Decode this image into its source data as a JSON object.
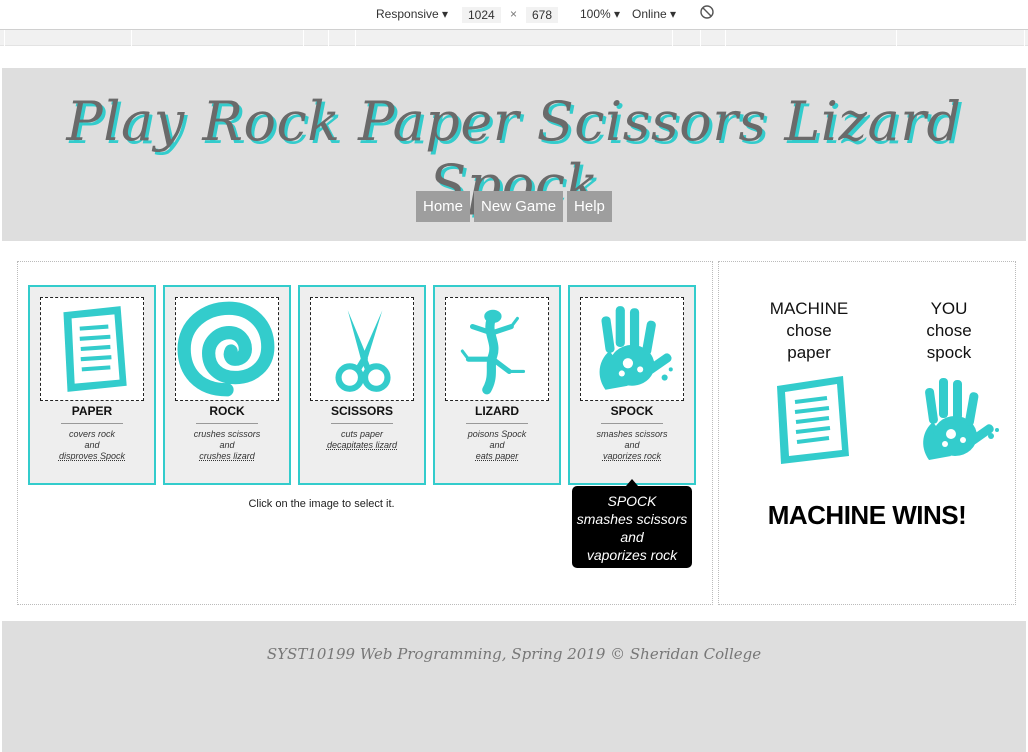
{
  "devtools": {
    "device": "Responsive",
    "width": "1024",
    "times": "×",
    "height": "678",
    "zoom": "100%",
    "network": "Online"
  },
  "header": {
    "title": "Play Rock Paper Scissors Lizard Spock",
    "nav": [
      "Home",
      "New Game",
      "Help"
    ]
  },
  "cards": [
    {
      "name": "PAPER",
      "lines": [
        "covers rock",
        "and",
        "disproves Spock"
      ],
      "icon": "paper-icon"
    },
    {
      "name": "ROCK",
      "lines": [
        "crushes scissors",
        "and",
        "crushes lizard"
      ],
      "icon": "rock-icon"
    },
    {
      "name": "SCISSORS",
      "lines": [
        "cuts paper",
        "decapitates lizard"
      ],
      "icon": "scissors-icon"
    },
    {
      "name": "LIZARD",
      "lines": [
        "poisons Spock",
        "and",
        "eats paper"
      ],
      "icon": "lizard-icon"
    },
    {
      "name": "SPOCK",
      "lines": [
        "smashes scissors",
        "and",
        "vaporizes rock"
      ],
      "icon": "spock-icon"
    }
  ],
  "hint": "Click on the image to select it.",
  "tooltip": {
    "lines": [
      "SPOCK",
      "smashes scissors",
      "and",
      "vaporizes rock"
    ]
  },
  "result": {
    "machine": [
      "MACHINE",
      "chose",
      "paper"
    ],
    "you": [
      "YOU",
      "chose",
      "spock"
    ],
    "outcome": "MACHINE WINS!"
  },
  "footer": "SYST10199 Web Programming, Spring 2019 © Sheridan College",
  "colors": {
    "accent": "#33cccc",
    "header_bg": "#dedede",
    "nav_bg": "#9e9e9e"
  }
}
